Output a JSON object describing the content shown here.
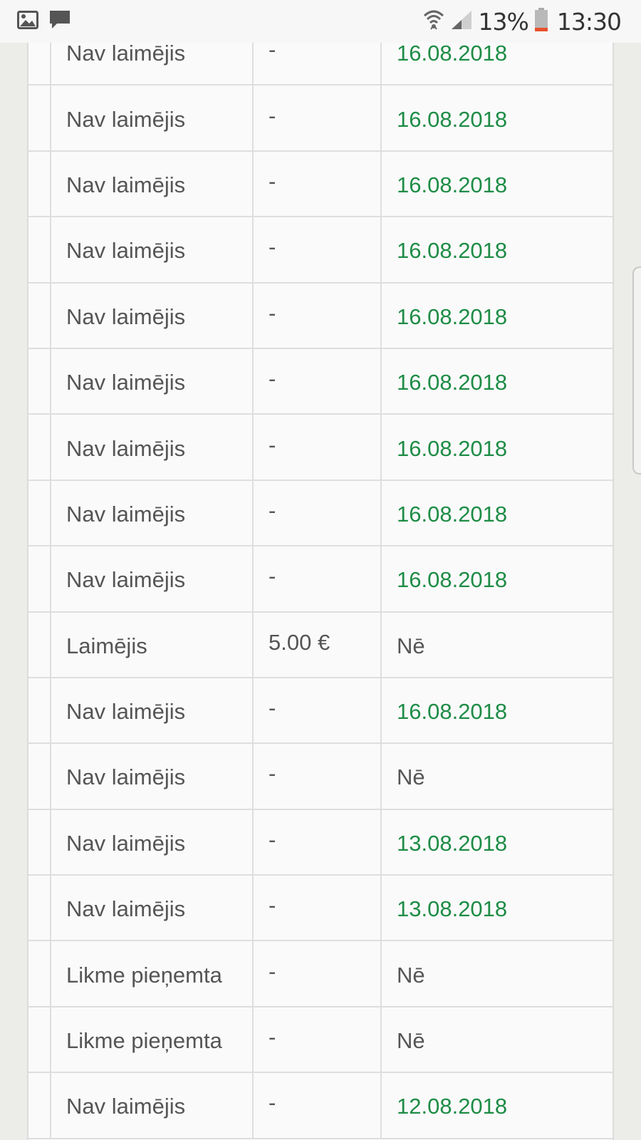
{
  "status_bar": {
    "left_icons": [
      "image-icon",
      "message-icon"
    ],
    "right_icons": [
      "wifi-icon",
      "signal-icon",
      "battery-icon"
    ],
    "battery_percent": "13%",
    "time": "13:30",
    "battery_color": "#e8502c"
  },
  "colors": {
    "date_green": "#1e8c46",
    "text_gray": "#555555"
  },
  "table": {
    "rows": [
      {
        "result": "Nav laimējis",
        "amount": "-",
        "payout": "16.08.2018",
        "payout_is_date": true
      },
      {
        "result": "Nav laimējis",
        "amount": "-",
        "payout": "16.08.2018",
        "payout_is_date": true
      },
      {
        "result": "Nav laimējis",
        "amount": "-",
        "payout": "16.08.2018",
        "payout_is_date": true
      },
      {
        "result": "Nav laimējis",
        "amount": "-",
        "payout": "16.08.2018",
        "payout_is_date": true
      },
      {
        "result": "Nav laimējis",
        "amount": "-",
        "payout": "16.08.2018",
        "payout_is_date": true
      },
      {
        "result": "Nav laimējis",
        "amount": "-",
        "payout": "16.08.2018",
        "payout_is_date": true
      },
      {
        "result": "Nav laimējis",
        "amount": "-",
        "payout": "16.08.2018",
        "payout_is_date": true
      },
      {
        "result": "Nav laimējis",
        "amount": "-",
        "payout": "16.08.2018",
        "payout_is_date": true
      },
      {
        "result": "Nav laimējis",
        "amount": "-",
        "payout": "16.08.2018",
        "payout_is_date": true
      },
      {
        "result": "Laimējis",
        "amount": "5.00 €",
        "payout": "Nē",
        "payout_is_date": false
      },
      {
        "result": "Nav laimējis",
        "amount": "-",
        "payout": "16.08.2018",
        "payout_is_date": true
      },
      {
        "result": "Nav laimējis",
        "amount": "-",
        "payout": "Nē",
        "payout_is_date": false
      },
      {
        "result": "Nav laimējis",
        "amount": "-",
        "payout": "13.08.2018",
        "payout_is_date": true
      },
      {
        "result": "Nav laimējis",
        "amount": "-",
        "payout": "13.08.2018",
        "payout_is_date": true
      },
      {
        "result": "Likme pieņemta",
        "amount": "-",
        "payout": "Nē",
        "payout_is_date": false
      },
      {
        "result": "Likme pieņemta",
        "amount": "-",
        "payout": "Nē",
        "payout_is_date": false
      },
      {
        "result": "Nav laimējis",
        "amount": "-",
        "payout": "12.08.2018",
        "payout_is_date": true
      }
    ]
  }
}
